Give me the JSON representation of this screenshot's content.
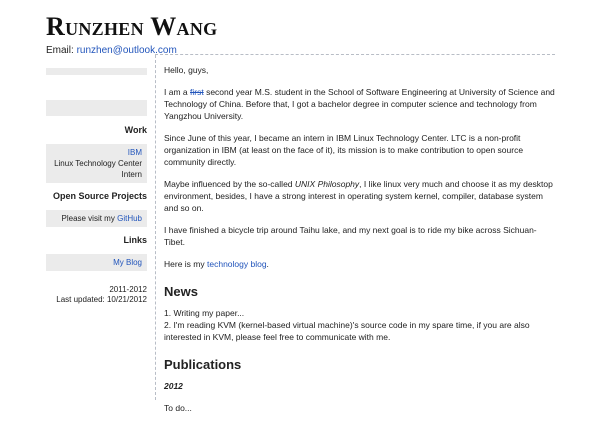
{
  "header": {
    "name": "Runzhen Wang",
    "email_label": "Email:",
    "email": "runzhen@outlook.com"
  },
  "sidebar": {
    "work": {
      "title": "Work",
      "company": "IBM",
      "department": "Linux Technology Center",
      "role": "Intern"
    },
    "projects": {
      "title": "Open Source Projects",
      "text": "Please visit my",
      "link": "GitHub"
    },
    "links": {
      "title": "Links",
      "blog": "My Blog"
    },
    "footer": {
      "years": "2011-2012",
      "updated": "Last updated: 10/21/2012"
    }
  },
  "main": {
    "greeting": "Hello, guys,",
    "intro": {
      "before": "I am a",
      "struck": "first",
      "after": "second year M.S. student in the School of Software Engineering at University of Science and Technology of China. Before that, I got a bachelor degree in computer science and technology from Yangzhou University."
    },
    "internship": "Since June of this year, I became an intern in IBM Linux Technology Center. LTC is a non-profit organization in IBM (at least on the face of it), its mission is to make contribution to open source community directly.",
    "philosophy": {
      "before": "Maybe influenced by the so-called",
      "term": "UNIX Philosophy",
      "after": ", I like linux very much and choose it as my desktop environment, besides, I have a strong interest in operating system kernel, compiler, database system and so on."
    },
    "bicycle": "I have finished a bicycle trip around Taihu lake, and my next goal is to ride my bike across Sichuan-Tibet.",
    "blog": {
      "before": "Here is my",
      "link": "technology blog",
      "after": "."
    },
    "news": {
      "title": "News",
      "item1": "1. Writing my paper...",
      "item2": "2. I'm reading KVM (kernel-based virtual machine)'s source code in my spare time, if you are also interested in KVM, please feel free to communicate with me."
    },
    "publications": {
      "title": "Publications",
      "year": "2012",
      "todo": "To do..."
    }
  }
}
